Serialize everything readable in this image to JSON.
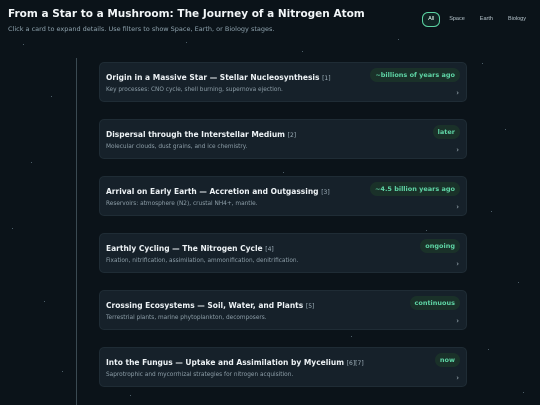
{
  "header": {
    "title": "From a Star to a Mushroom: The Journey of a Nitrogen Atom",
    "subtitle": "Click a card to expand details. Use filters to show Space, Earth, or Biology stages."
  },
  "filters": [
    "All",
    "Space",
    "Earth",
    "Biology"
  ],
  "active_filter": "All",
  "icons": {
    "expand": "chevron-right-icon"
  },
  "colors": {
    "accent": "#5fd6a6",
    "background": "#0b1319",
    "card": "#16212a"
  },
  "cards": [
    {
      "title": "Origin in a Massive Star — Stellar Nucleosynthesis",
      "ref": "[1]",
      "description": "Key processes: CNO cycle, shell burning, supernova ejection.",
      "badge": "~billions of years ago"
    },
    {
      "title": "Dispersal through the Interstellar Medium",
      "ref": "[2]",
      "description": "Molecular clouds, dust grains, and ice chemistry.",
      "badge": "later"
    },
    {
      "title": "Arrival on Early Earth — Accretion and Outgassing",
      "ref": "[3]",
      "description": "Reservoirs: atmosphere (N2), crustal NH4+, mantle.",
      "badge": "~4.5 billion years ago"
    },
    {
      "title": "Earthly Cycling — The Nitrogen Cycle",
      "ref": "[4]",
      "description": "Fixation, nitrification, assimilation, ammonification, denitrification.",
      "badge": "ongoing"
    },
    {
      "title": "Crossing Ecosystems — Soil, Water, and Plants",
      "ref": "[5]",
      "description": "Terrestrial plants, marine phytoplankton, decomposers.",
      "badge": "continuous"
    },
    {
      "title": "Into the Fungus — Uptake and Assimilation by Mycelium",
      "ref": "[6][7]",
      "description": "Saprotrophic and mycorrhizal strategies for nitrogen acquisition.",
      "badge": "now"
    }
  ]
}
